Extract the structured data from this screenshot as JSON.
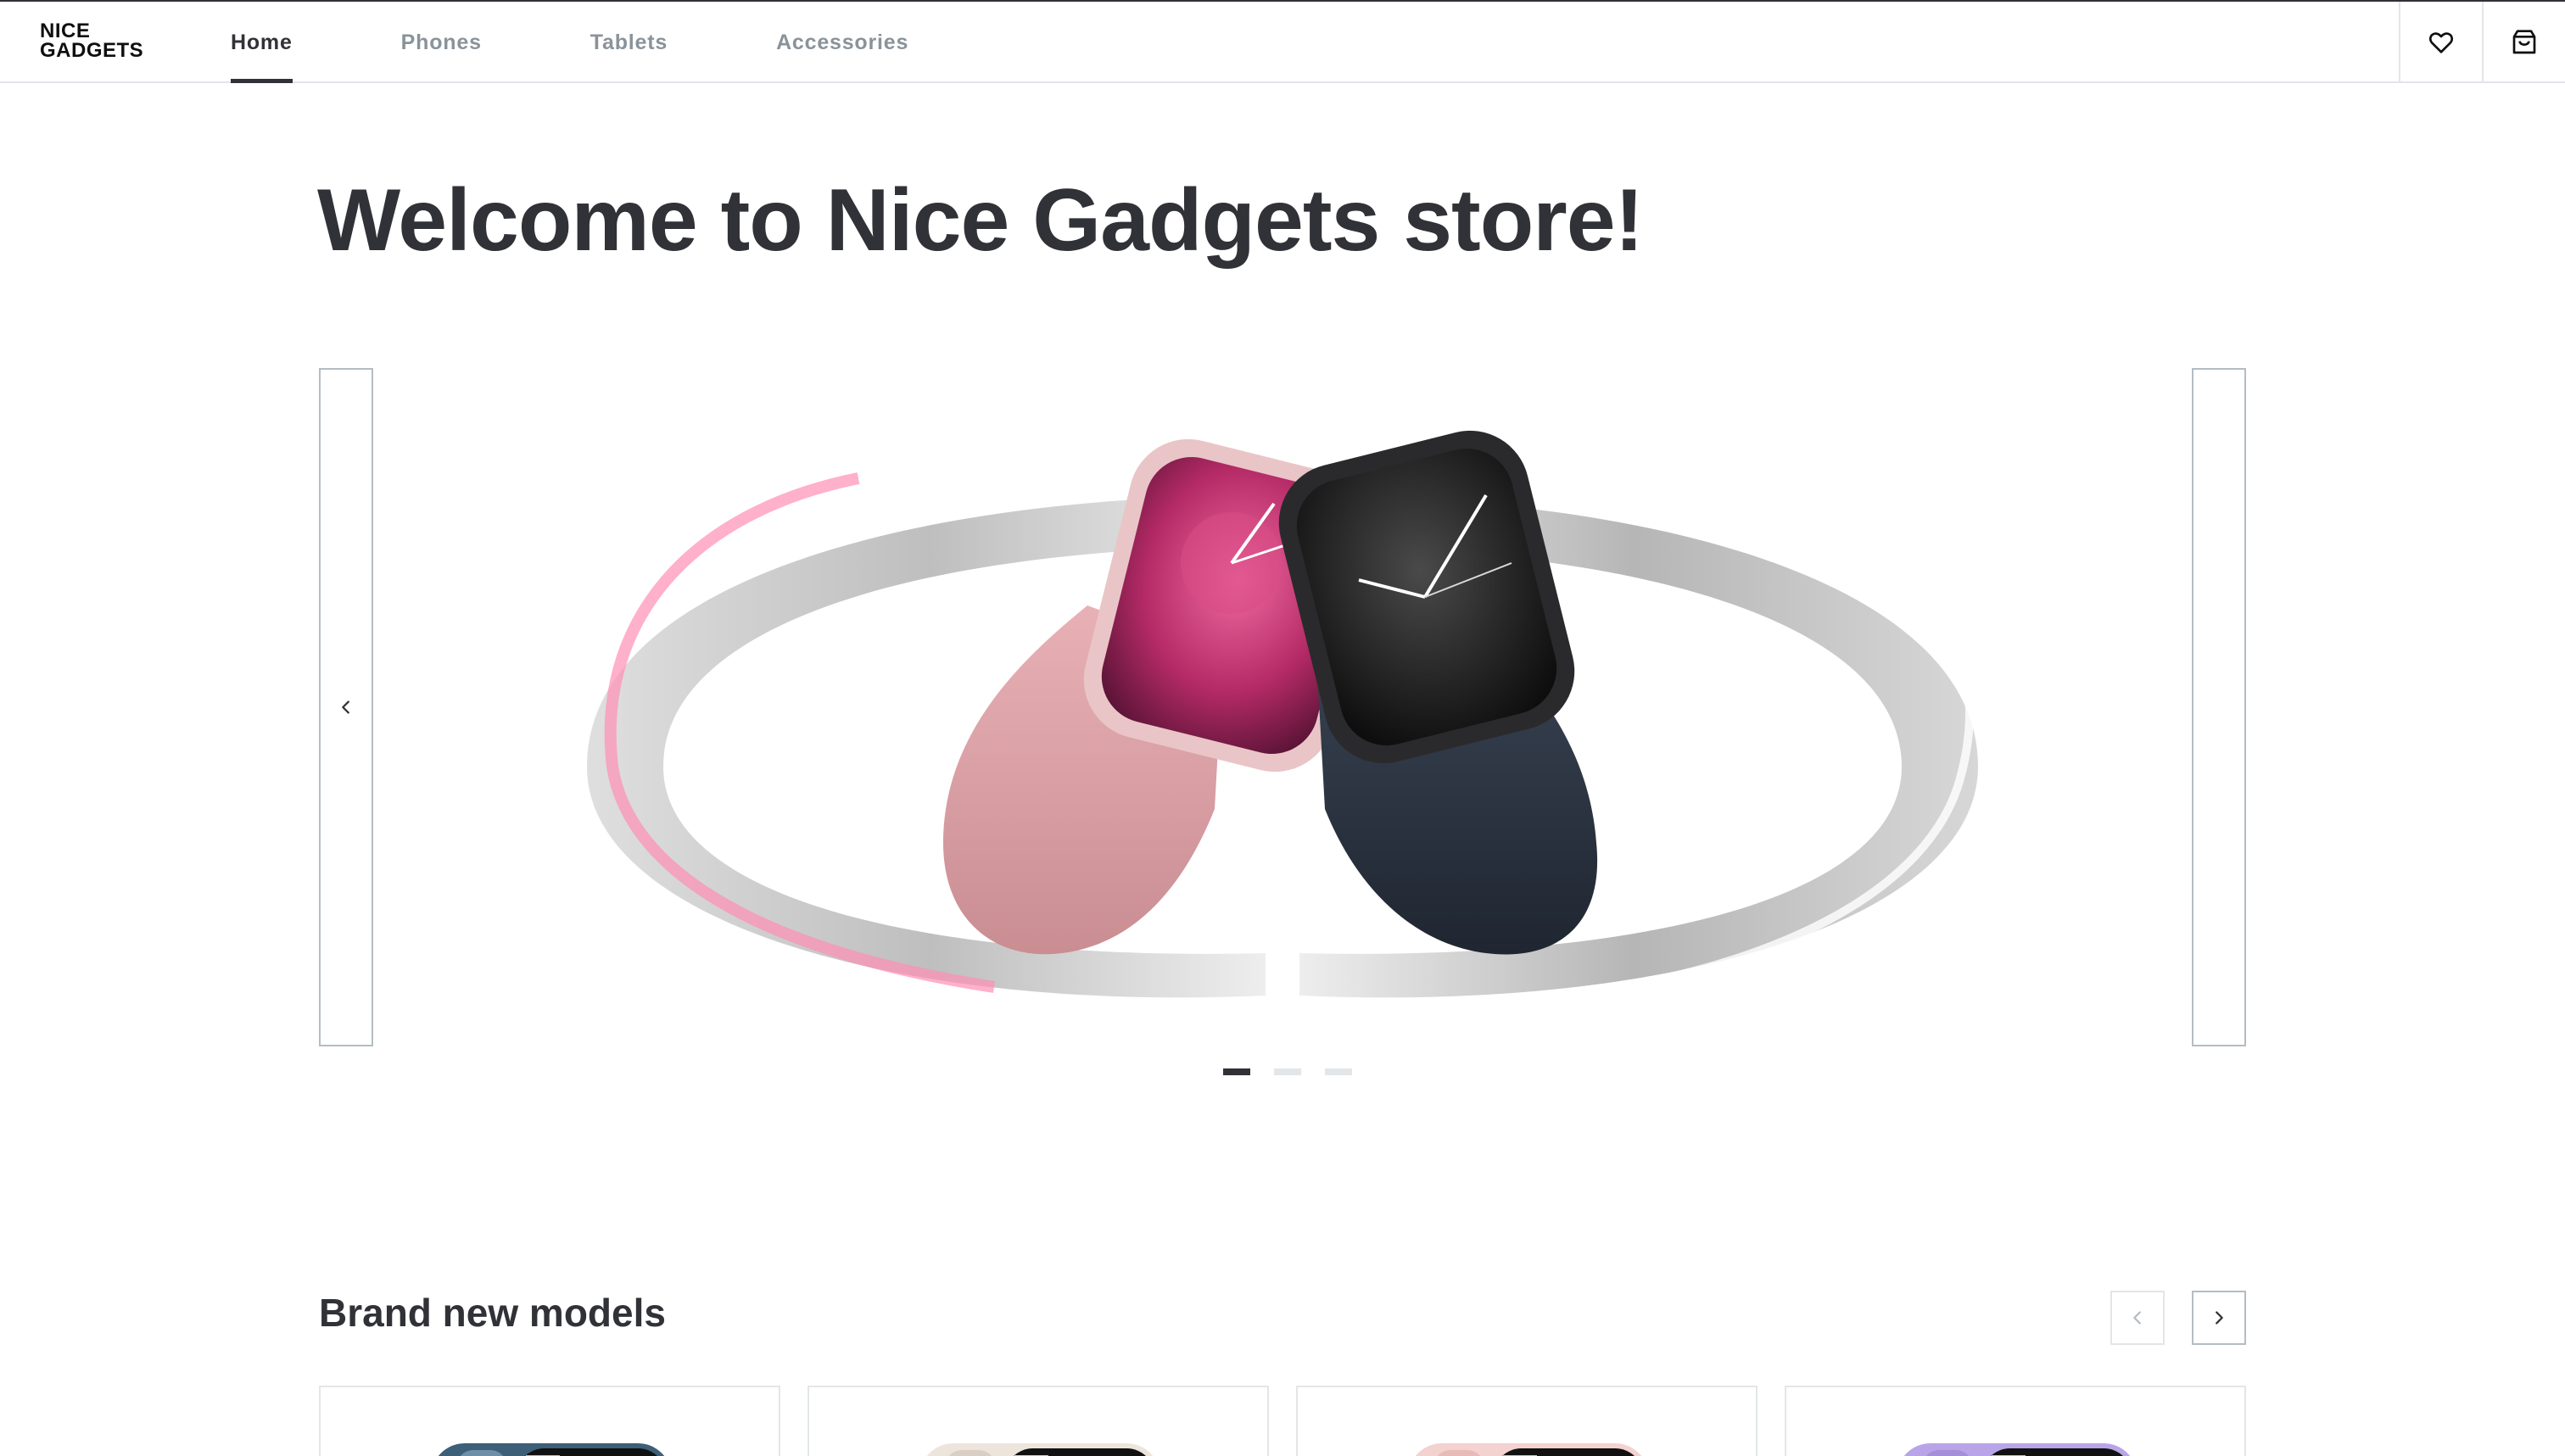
{
  "header": {
    "logo_line1": "NICE",
    "logo_line2": "GADGETS",
    "nav": [
      {
        "label": "Home",
        "active": true
      },
      {
        "label": "Phones",
        "active": false
      },
      {
        "label": "Tablets",
        "active": false
      },
      {
        "label": "Accessories",
        "active": false
      }
    ],
    "icons": [
      "heart-icon",
      "shopping-bag-icon"
    ]
  },
  "main": {
    "title": "Welcome to Nice Gadgets store!",
    "slider": {
      "slides_total": 3,
      "active_slide": 1,
      "prev_icon": "chevron-left-icon",
      "next_icon": "",
      "image": "apple-watch-banner"
    },
    "brand_new": {
      "title": "Brand new models",
      "prev_icon": "chevron-left-icon",
      "next_icon": "chevron-right-icon",
      "cards": [
        {
          "image": "phone-blue"
        },
        {
          "image": "phone-starlight"
        },
        {
          "image": "phone-pink"
        },
        {
          "image": "phone-purple"
        }
      ]
    }
  },
  "colors": {
    "primary": "#313237",
    "secondary": "#89939a",
    "border": "#e2e6e9",
    "accent_pink": "#e0a1b4",
    "watch_dark": "#2b3340"
  }
}
